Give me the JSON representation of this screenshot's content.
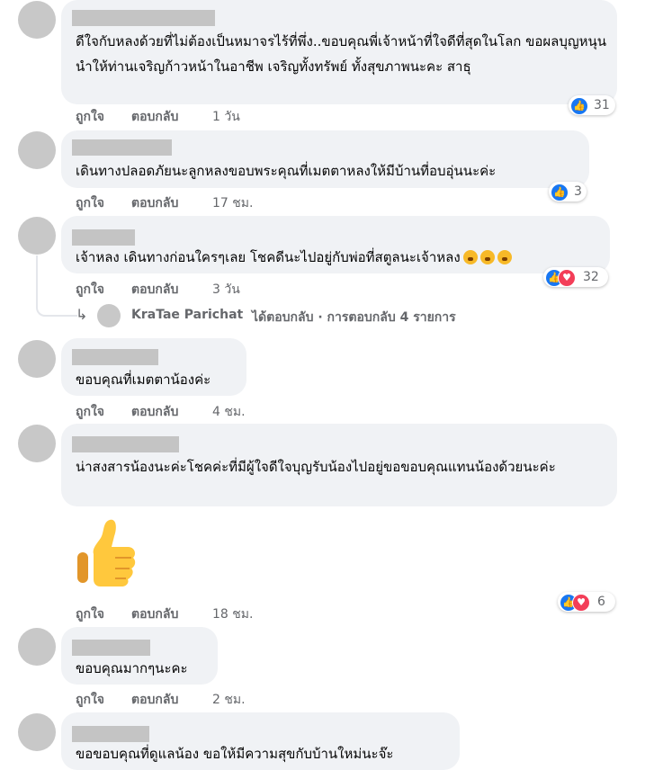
{
  "actions": {
    "like_label": "ถูกใจ",
    "reply_label": "ตอบกลับ"
  },
  "comments": [
    {
      "text": "ดีใจกับหลงด้วยที่ไม่ต้องเป็นหมาจรไร้ที่พึ่ง..ขอบคุณพี่เจ้าหน้าที่ใจดีที่สุดในโลก ขอผลบุญหนุนนำให้ท่านเจริญก้าวหน้าในอาชีพ เจริญทั้งทรัพย์ ทั้งสุขภาพนะคะ สาธุ",
      "time": "1 วัน",
      "reaction_count": "31",
      "reaction_icons": [
        "like-icon"
      ]
    },
    {
      "text": "เดินทางปลอดภัยนะลูกหลงขอบพระคุณที่เมตตาหลงให้มีบ้านที่อบอุ่นนะค่ะ",
      "time": "17 ชม.",
      "reaction_count": "3",
      "reaction_icons": [
        "like-icon"
      ]
    },
    {
      "text": "เจ้าหลง เดินทางก่อนใครๆเลย โชคดีนะไปอยู่กับพ่อที่สตูลนะเจ้าหลง",
      "time": "3 วัน",
      "reaction_count": "32",
      "reaction_icons": [
        "like-icon",
        "love-icon"
      ],
      "emojis": [
        "crying-face-icon",
        "crying-face-icon",
        "crying-face-icon"
      ]
    },
    {
      "text": "ขอบคุณที่เมตตาน้องค่ะ",
      "time": "4 ชม."
    },
    {
      "text": "น่าสงสารน้องนะค่ะโชคค่ะที่มีผู้ใจดีใจบุญรับน้องไปอยู่ขอขอบคุณแทนน้องด้วยนะค่ะ",
      "time": "18 ชม.",
      "reaction_count": "6",
      "reaction_icons": [
        "like-icon",
        "love-icon"
      ],
      "sticker": "thumbs-up-sticker"
    },
    {
      "text": "ขอบคุณมากๆนะคะ",
      "time": "2 ชม."
    },
    {
      "text": "ขอขอบคุณที่ดูแลน้อง ขอให้มีความสุขกับบ้านใหม่นะจ๊ะ"
    }
  ],
  "reply_thread": {
    "author": "KraTae Parichat",
    "summary": "ได้ตอบกลับ · การตอบกลับ 4 รายการ"
  },
  "colors": {
    "like": "#1877f2",
    "love": "#f33e58",
    "bubble": "#f0f2f5",
    "meta_text": "#65676b"
  }
}
